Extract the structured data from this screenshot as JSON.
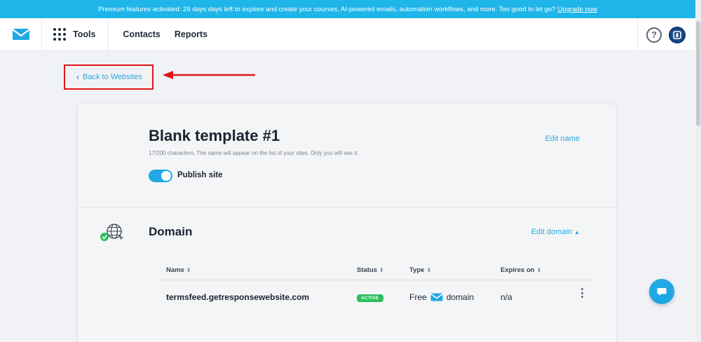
{
  "banner": {
    "text": "Premium features activated: 29 days days left to explore and create your courses, AI-powered emails, automation workflows, and more. Too good to let go?",
    "link": "Upgrade now"
  },
  "nav": {
    "tools": "Tools",
    "contacts": "Contacts",
    "reports": "Reports",
    "help_icon": "question-icon",
    "avatar_icon": "avatar-icon"
  },
  "back": {
    "label": "Back to Websites",
    "icon": "chevron-left-icon"
  },
  "site": {
    "title": "Blank template #1",
    "hint": "17/200 characters. The name will appear on the list of your sites. Only you will see it.",
    "edit_name": "Edit name",
    "publish_label": "Publish site",
    "publish_on": true
  },
  "domain": {
    "title": "Domain",
    "edit_label": "Edit domain",
    "columns": {
      "name": "Name",
      "status": "Status",
      "type": "Type",
      "expires": "Expires on"
    },
    "row": {
      "name": "termsfeed.getresponsewebsite.com",
      "status": "ACTIVE",
      "type_prefix": "Free",
      "type_suffix": "domain",
      "expires": "n/a"
    }
  },
  "colors": {
    "accent": "#1fa8e3",
    "banner": "#1fb5e8",
    "active_badge": "#2bbf5c",
    "highlight_box": "#e1161b"
  }
}
